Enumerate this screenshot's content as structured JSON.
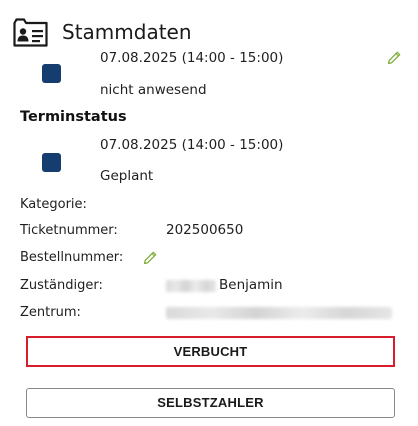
{
  "header": {
    "title": "Stammdaten",
    "icon": "id-card-icon"
  },
  "status_entry": {
    "datetime": "07.08.2025 (14:00 - 15:00)",
    "status": "nicht anwesend",
    "square_color": "#163d6f",
    "edit_icon": "pencil-icon"
  },
  "terminstatus": {
    "title": "Terminstatus",
    "datetime": "07.08.2025 (14:00 - 15:00)",
    "status": "Geplant",
    "square_color": "#163d6f"
  },
  "fields": {
    "kategorie_label": "Kategorie:",
    "ticketnummer_label": "Ticketnummer:",
    "ticketnummer_value": "202500650",
    "bestellnummer_label": "Bestellnummer:",
    "zustaendiger_label": "Zuständiger:",
    "zustaendiger_value": "Benjamin",
    "zentrum_label": "Zentrum:"
  },
  "buttons": {
    "verbucht": "VERBUCHT",
    "selbstzahler": "SELBSTZAHLER"
  },
  "colors": {
    "accent_red": "#d81d2c",
    "pencil_green": "#7fae3a"
  }
}
